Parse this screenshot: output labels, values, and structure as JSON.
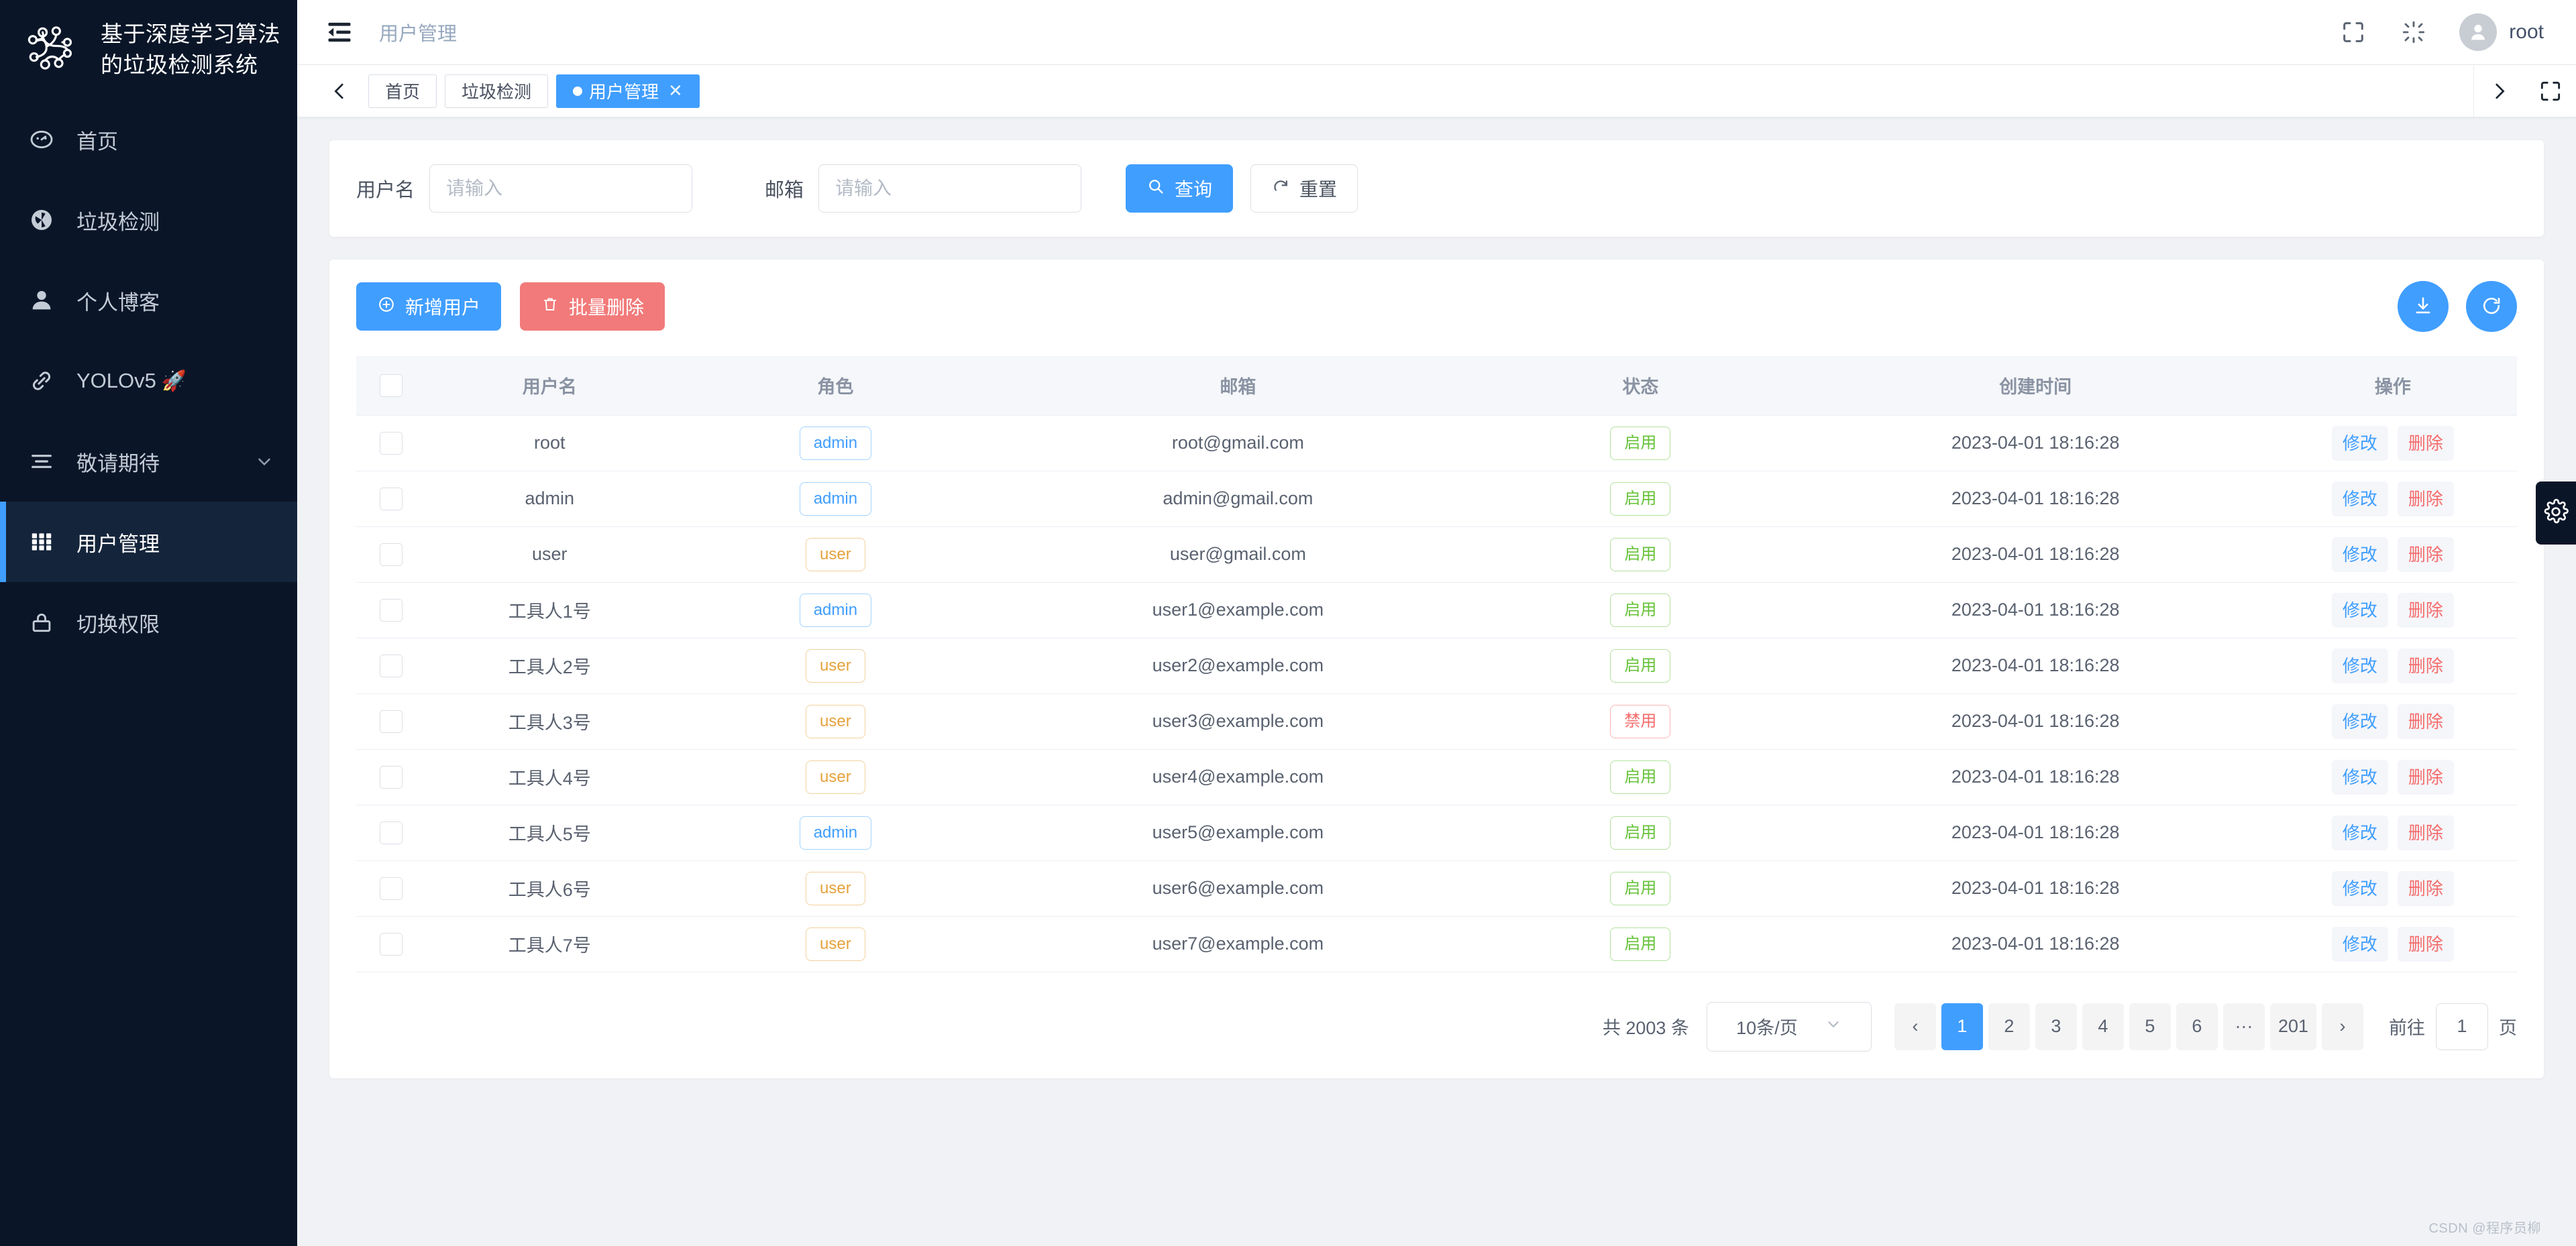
{
  "sidebar": {
    "logo_title_line1": "基于深度学习算法",
    "logo_title_line2": "的垃圾检测系统",
    "items": [
      {
        "label": "首页",
        "icon": "dashboard-icon",
        "active": false
      },
      {
        "label": "垃圾检测",
        "icon": "detect-icon",
        "active": false
      },
      {
        "label": "个人博客",
        "icon": "user-icon",
        "active": false
      },
      {
        "label": "YOLOv5",
        "icon": "link-icon",
        "active": false,
        "emoji": "🚀"
      },
      {
        "label": "敬请期待",
        "icon": "menu-list-icon",
        "active": false,
        "expandable": true
      },
      {
        "label": "用户管理",
        "icon": "grid-icon",
        "active": true
      },
      {
        "label": "切换权限",
        "icon": "lock-icon",
        "active": false
      }
    ]
  },
  "header": {
    "collapse_icon": "collapse-menu-icon",
    "breadcrumb": "用户管理",
    "fullscreen_icon": "fullscreen-icon",
    "theme_icon": "brightness-icon",
    "avatar_icon": "avatar-icon",
    "username": "root"
  },
  "tabbar": {
    "prev_icon": "chevron-left-icon",
    "next_icon": "chevron-right-icon",
    "fullscreen_icon": "fullscreen-icon",
    "tabs": [
      {
        "label": "首页",
        "active": false,
        "closable": false
      },
      {
        "label": "垃圾检测",
        "active": false,
        "closable": false
      },
      {
        "label": "用户管理",
        "active": true,
        "closable": true,
        "close_glyph": "✕"
      }
    ]
  },
  "search": {
    "username_label": "用户名",
    "username_value": "",
    "username_placeholder": "请输入",
    "email_label": "邮箱",
    "email_value": "",
    "email_placeholder": "请输入",
    "query_label": "查询",
    "query_icon": "search-icon",
    "reset_label": "重置",
    "reset_icon": "refresh-icon"
  },
  "toolbar": {
    "add_label": "新增用户",
    "add_icon": "plus-circle-icon",
    "delete_label": "批量删除",
    "delete_icon": "trash-icon",
    "download_icon": "download-icon",
    "refresh_icon": "refresh-circle-icon"
  },
  "table": {
    "columns": [
      "",
      "用户名",
      "角色",
      "邮箱",
      "状态",
      "创建时间",
      "操作"
    ],
    "edit_label": "修改",
    "delete_label": "删除",
    "rows": [
      {
        "username": "root",
        "role": "admin",
        "email": "root@gmail.com",
        "status": "启用",
        "created": "2023-04-01 18:16:28"
      },
      {
        "username": "admin",
        "role": "admin",
        "email": "admin@gmail.com",
        "status": "启用",
        "created": "2023-04-01 18:16:28"
      },
      {
        "username": "user",
        "role": "user",
        "email": "user@gmail.com",
        "status": "启用",
        "created": "2023-04-01 18:16:28"
      },
      {
        "username": "工具人1号",
        "role": "admin",
        "email": "user1@example.com",
        "status": "启用",
        "created": "2023-04-01 18:16:28"
      },
      {
        "username": "工具人2号",
        "role": "user",
        "email": "user2@example.com",
        "status": "启用",
        "created": "2023-04-01 18:16:28"
      },
      {
        "username": "工具人3号",
        "role": "user",
        "email": "user3@example.com",
        "status": "禁用",
        "created": "2023-04-01 18:16:28"
      },
      {
        "username": "工具人4号",
        "role": "user",
        "email": "user4@example.com",
        "status": "启用",
        "created": "2023-04-01 18:16:28"
      },
      {
        "username": "工具人5号",
        "role": "admin",
        "email": "user5@example.com",
        "status": "启用",
        "created": "2023-04-01 18:16:28"
      },
      {
        "username": "工具人6号",
        "role": "user",
        "email": "user6@example.com",
        "status": "启用",
        "created": "2023-04-01 18:16:28"
      },
      {
        "username": "工具人7号",
        "role": "user",
        "email": "user7@example.com",
        "status": "启用",
        "created": "2023-04-01 18:16:28"
      }
    ]
  },
  "pagination": {
    "total_text": "共 2003 条",
    "page_size_label": "10条/页",
    "prev_glyph": "‹",
    "next_glyph": "›",
    "pages": [
      "1",
      "2",
      "3",
      "4",
      "5",
      "6",
      "···",
      "201"
    ],
    "current_page": "1",
    "jump_prefix": "前往",
    "jump_value": "1",
    "jump_suffix": "页"
  },
  "settings_handle_icon": "gear-icon",
  "watermark": "CSDN @程序员柳",
  "colors": {
    "sidebar_bg": "#0a1628",
    "sidebar_active_bg": "#14243b",
    "accent": "#409eff",
    "danger": "#f56c6c",
    "success": "#67c23a",
    "warning": "#e6a23c"
  }
}
